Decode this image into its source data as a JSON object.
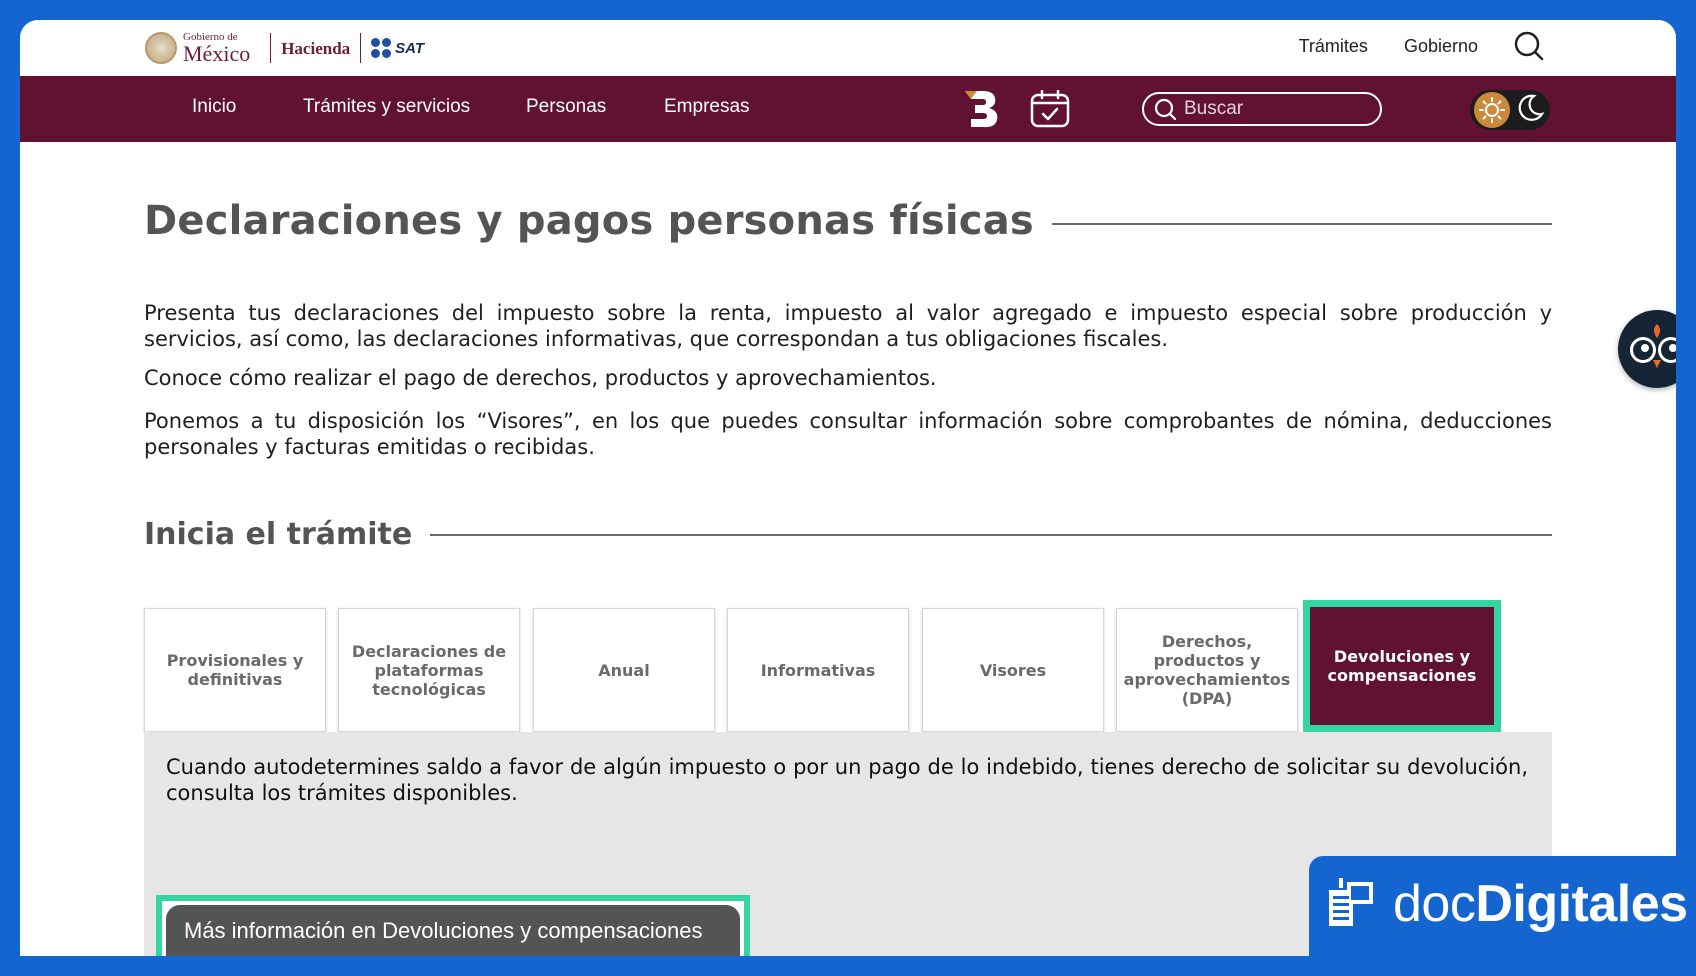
{
  "header": {
    "logo_gob_small": "Gobierno de",
    "logo_gob_big": "México",
    "logo_hacienda": "Hacienda",
    "logo_sat": "SAT",
    "links": [
      "Trámites",
      "Gobierno"
    ]
  },
  "nav": {
    "items": [
      "Inicio",
      "Trámites y servicios",
      "Personas",
      "Empresas"
    ],
    "search_placeholder": "Buscar"
  },
  "page": {
    "title": "Declaraciones y pagos personas físicas",
    "paragraphs": [
      "Presenta tus declaraciones del impuesto sobre la renta, impuesto al valor agregado e impuesto especial sobre producción y servicios, así como, las declaraciones informativas, que correspondan a tus obligaciones fiscales.",
      "Conoce cómo realizar el pago de derechos, productos y aprovechamientos.",
      "Ponemos a tu disposición los “Visores”, en los que puedes consultar información sobre comprobantes de nómina, deducciones personales y facturas emitidas o recibidas."
    ],
    "section_title": "Inicia el trámite"
  },
  "tabs": [
    {
      "label": "Provisionales y definitivas"
    },
    {
      "label": "Declaraciones de plataformas tecnológicas"
    },
    {
      "label": "Anual"
    },
    {
      "label": "Informativas"
    },
    {
      "label": "Visores"
    },
    {
      "label": "Derechos, productos y aprovechamientos (DPA)"
    },
    {
      "label": "Devoluciones y compensaciones"
    }
  ],
  "active_tab": "Devoluciones y compensaciones",
  "panel": {
    "text": "Cuando autodetermines saldo a favor de algún impuesto o por un pago de lo indebido, tienes derecho de solicitar su devolución, consulta los trámites disponibles.",
    "button_label": "Más información en Devoluciones y compensaciones"
  },
  "watermark": {
    "prefix": "doc",
    "bold": "Digitales"
  },
  "colors": {
    "frame_blue": "#1565d0",
    "nav_bg": "#611232",
    "highlight": "#33d6a0",
    "panel_bg": "#e6e6e6"
  }
}
